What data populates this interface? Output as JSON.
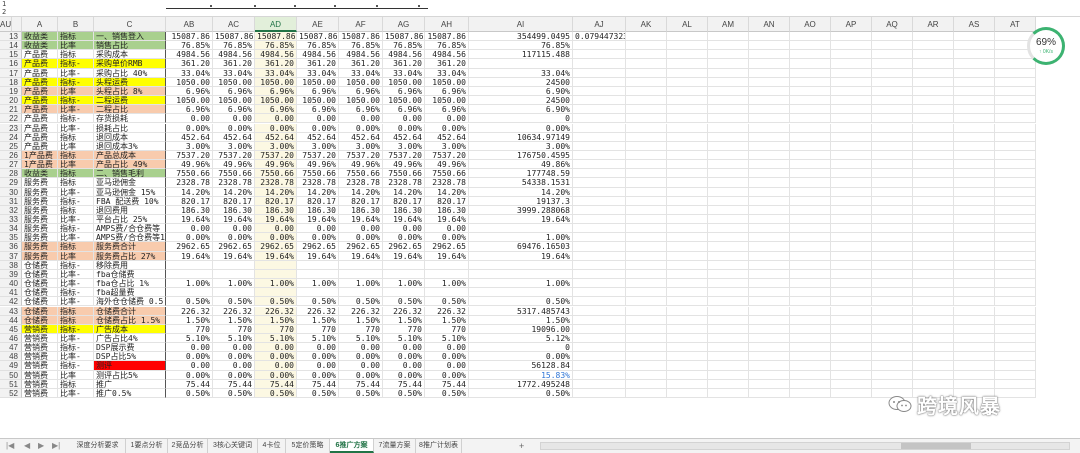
{
  "colors": {
    "green": "#a9d08e",
    "yellow": "#ffff00",
    "orange": "#f8cbad",
    "red": "#ff0000",
    "selected_col_fill": "#fcf8e3",
    "accent": "#217346"
  },
  "columns": [
    "A",
    "B",
    "C",
    "AB",
    "AC",
    "AD",
    "AE",
    "AF",
    "AG",
    "AH",
    "AI",
    "AJ",
    "AK",
    "AL",
    "AM",
    "AN",
    "AO",
    "AP",
    "AQ",
    "AR",
    "AS",
    "AT",
    "AU"
  ],
  "selected_column": "AD",
  "top_rows": [
    "1",
    "2"
  ],
  "rows": [
    {
      "n": "13",
      "a": "收益类",
      "b": "指标",
      "c": "一、销售登入",
      "v": [
        "15087.86",
        "15087.86",
        "15087.86",
        "15087.86",
        "15087.86",
        "15087.86",
        "15087.86"
      ],
      "ai": "354499.0495",
      "aj": "0.079447323",
      "fill": "green"
    },
    {
      "n": "14",
      "a": "收益类",
      "b": "比率",
      "c": "销售占比",
      "v": [
        "76.85%",
        "76.85%",
        "76.85%",
        "76.85%",
        "76.85%",
        "76.85%",
        "76.85%"
      ],
      "ai": "76.85%",
      "fill": "green"
    },
    {
      "n": "15",
      "a": "产品费",
      "b": "指标",
      "c": "采购成本",
      "v": [
        "4984.56",
        "4984.56",
        "4984.56",
        "4984.56",
        "4984.56",
        "4984.56",
        "4984.56"
      ],
      "ai": "117115.488"
    },
    {
      "n": "16",
      "a": "产品费",
      "b": "指标-",
      "c": "采购单价RMB",
      "v": [
        "361.20",
        "361.20",
        "361.20",
        "361.20",
        "361.20",
        "361.20",
        "361.20"
      ],
      "ai": "",
      "fill": "yellow"
    },
    {
      "n": "17",
      "a": "产品费",
      "b": "比率-",
      "c": "采购占比 40%",
      "v": [
        "33.04%",
        "33.04%",
        "33.04%",
        "33.04%",
        "33.04%",
        "33.04%",
        "33.04%"
      ],
      "ai": "33.04%"
    },
    {
      "n": "18",
      "a": "产品费",
      "b": "指标-",
      "c": "头程运费",
      "v": [
        "1050.00",
        "1050.00",
        "1050.00",
        "1050.00",
        "1050.00",
        "1050.00",
        "1050.00"
      ],
      "ai": "24500",
      "fill": "yellow"
    },
    {
      "n": "19",
      "a": "产品费",
      "b": "比率",
      "c": "头程占比 8%",
      "v": [
        "6.96%",
        "6.96%",
        "6.96%",
        "6.96%",
        "6.96%",
        "6.96%",
        "6.96%"
      ],
      "ai": "6.90%",
      "fill": "orange"
    },
    {
      "n": "20",
      "a": "产品费",
      "b": "指标-",
      "c": "二程运费",
      "v": [
        "1050.00",
        "1050.00",
        "1050.00",
        "1050.00",
        "1050.00",
        "1050.00",
        "1050.00"
      ],
      "ai": "24500",
      "fill": "yellow"
    },
    {
      "n": "21",
      "a": "产品费",
      "b": "比率-",
      "c": "二程占比",
      "v": [
        "6.96%",
        "6.96%",
        "6.96%",
        "6.96%",
        "6.96%",
        "6.96%",
        "6.96%"
      ],
      "ai": "6.90%",
      "fill": "orange"
    },
    {
      "n": "22",
      "a": "产品费",
      "b": "指标-",
      "c": "存货损耗",
      "v": [
        "0.00",
        "0.00",
        "0.00",
        "0.00",
        "0.00",
        "0.00",
        "0.00"
      ],
      "ai": "0"
    },
    {
      "n": "23",
      "a": "产品费",
      "b": "比率-",
      "c": "损耗占比",
      "v": [
        "0.00%",
        "0.00%",
        "0.00%",
        "0.00%",
        "0.00%",
        "0.00%",
        "0.00%"
      ],
      "ai": "0.00%"
    },
    {
      "n": "24",
      "a": "产品费",
      "b": "指标",
      "c": "退回成本",
      "v": [
        "452.64",
        "452.64",
        "452.64",
        "452.64",
        "452.64",
        "452.64",
        "452.64"
      ],
      "ai": "10634.97149"
    },
    {
      "n": "25",
      "a": "产品费",
      "b": "比率",
      "c": "退回成本3%",
      "v": [
        "3.00%",
        "3.00%",
        "3.00%",
        "3.00%",
        "3.00%",
        "3.00%",
        "3.00%"
      ],
      "ai": "3.00%"
    },
    {
      "n": "26",
      "a": "1产品费",
      "b": "指标",
      "c": "产品总成本",
      "v": [
        "7537.20",
        "7537.20",
        "7537.20",
        "7537.20",
        "7537.20",
        "7537.20",
        "7537.20"
      ],
      "ai": "176750.4595",
      "fill": "orange"
    },
    {
      "n": "27",
      "a": "1产品费",
      "b": "比率",
      "c": "产品占比 49%",
      "v": [
        "49.96%",
        "49.96%",
        "49.96%",
        "49.96%",
        "49.96%",
        "49.96%",
        "49.96%"
      ],
      "ai": "49.86%",
      "fill": "orange"
    },
    {
      "n": "28",
      "a": "收益类",
      "b": "指标",
      "c": "二、销售毛利",
      "v": [
        "7550.66",
        "7550.66",
        "7550.66",
        "7550.66",
        "7550.66",
        "7550.66",
        "7550.66"
      ],
      "ai": "177748.59",
      "fill": "green"
    },
    {
      "n": "29",
      "a": "服务费",
      "b": "指标",
      "c": "亚马逊佣金",
      "v": [
        "2328.78",
        "2328.78",
        "2328.78",
        "2328.78",
        "2328.78",
        "2328.78",
        "2328.78"
      ],
      "ai": "54338.1531"
    },
    {
      "n": "30",
      "a": "服务费",
      "b": "比率-",
      "c": "亚马逊佣金 15%",
      "v": [
        "14.20%",
        "14.20%",
        "14.20%",
        "14.20%",
        "14.20%",
        "14.20%",
        "14.20%"
      ],
      "ai": "14.20%"
    },
    {
      "n": "31",
      "a": "服务费",
      "b": "指标-",
      "c": "FBA 配送费 10%",
      "v": [
        "820.17",
        "820.17",
        "820.17",
        "820.17",
        "820.17",
        "820.17",
        "820.17"
      ],
      "ai": "19137.3"
    },
    {
      "n": "32",
      "a": "服务费",
      "b": "指标",
      "c": "退回费用",
      "v": [
        "186.30",
        "186.30",
        "186.30",
        "186.30",
        "186.30",
        "186.30",
        "186.30"
      ],
      "ai": "3999.288068"
    },
    {
      "n": "33",
      "a": "服务费",
      "b": "比率-",
      "c": "平台占比 25%",
      "v": [
        "19.64%",
        "19.64%",
        "19.64%",
        "19.64%",
        "19.64%",
        "19.64%",
        "19.64%"
      ],
      "ai": "19.64%"
    },
    {
      "n": "34",
      "a": "服务费",
      "b": "指标-",
      "c": "AMPS费/合仓费等",
      "v": [
        "0.00",
        "0.00",
        "0.00",
        "0.00",
        "0.00",
        "0.00",
        "0.00"
      ],
      "ai": ""
    },
    {
      "n": "35",
      "a": "服务费",
      "b": "比率-",
      "c": "AMPS费/合仓费等1",
      "v": [
        "0.00%",
        "0.00%",
        "0.00%",
        "0.00%",
        "0.00%",
        "0.00%",
        "0.00%"
      ],
      "ai": "1.00%"
    },
    {
      "n": "36",
      "a": "服务费",
      "b": "指标",
      "c": "服务费合计",
      "v": [
        "2962.65",
        "2962.65",
        "2962.65",
        "2962.65",
        "2962.65",
        "2962.65",
        "2962.65"
      ],
      "ai": "69476.16503",
      "fill": "orange"
    },
    {
      "n": "37",
      "a": "服务费",
      "b": "比率",
      "c": "服务费占比 27%",
      "v": [
        "19.64%",
        "19.64%",
        "19.64%",
        "19.64%",
        "19.64%",
        "19.64%",
        "19.64%"
      ],
      "ai": "19.64%",
      "fill": "orange"
    },
    {
      "n": "38",
      "a": "仓储费",
      "b": "指标-",
      "c": "移除费用",
      "v": [
        "",
        "",
        "",
        "",
        "",
        "",
        ""
      ],
      "ai": ""
    },
    {
      "n": "39",
      "a": "仓储费",
      "b": "比率-",
      "c": "fba仓储费",
      "v": [
        "",
        "",
        "",
        "",
        "",
        "",
        ""
      ],
      "ai": ""
    },
    {
      "n": "40",
      "a": "仓储费",
      "b": "比率-",
      "c": "fba仓占比 1%",
      "v": [
        "1.00%",
        "1.00%",
        "1.00%",
        "1.00%",
        "1.00%",
        "1.00%",
        "1.00%"
      ],
      "ai": "1.00%"
    },
    {
      "n": "41",
      "a": "仓储费",
      "b": "指标-",
      "c": "fba超量费",
      "v": [
        "",
        "",
        "",
        "",
        "",
        "",
        ""
      ],
      "ai": ""
    },
    {
      "n": "42",
      "a": "仓储费",
      "b": "比率-",
      "c": "海外仓仓储费 0.5",
      "v": [
        "0.50%",
        "0.50%",
        "0.50%",
        "0.50%",
        "0.50%",
        "0.50%",
        "0.50%"
      ],
      "ai": "0.50%"
    },
    {
      "n": "43",
      "a": "仓储费",
      "b": "指标",
      "c": "仓储费合计",
      "v": [
        "226.32",
        "226.32",
        "226.32",
        "226.32",
        "226.32",
        "226.32",
        "226.32"
      ],
      "ai": "5317.485743",
      "fill": "orange"
    },
    {
      "n": "44",
      "a": "仓储费",
      "b": "指标",
      "c": "仓储费占比 1.5%",
      "v": [
        "1.50%",
        "1.50%",
        "1.50%",
        "1.50%",
        "1.50%",
        "1.50%",
        "1.50%"
      ],
      "ai": "1.50%",
      "fill": "orange"
    },
    {
      "n": "45",
      "a": "营销费",
      "b": "指标-",
      "c": "广告成本",
      "v": [
        "770",
        "770",
        "770",
        "770",
        "770",
        "770",
        "770"
      ],
      "ai": "19096.00",
      "fill": "yellow"
    },
    {
      "n": "46",
      "a": "营销费",
      "b": "比率-",
      "c": "广告占比4%",
      "v": [
        "5.10%",
        "5.10%",
        "5.10%",
        "5.10%",
        "5.10%",
        "5.10%",
        "5.10%"
      ],
      "ai": "5.12%"
    },
    {
      "n": "47",
      "a": "营销费",
      "b": "指标-",
      "c": "DSP展示费",
      "v": [
        "0.00",
        "0.00",
        "0.00",
        "0.00",
        "0.00",
        "0.00",
        "0.00"
      ],
      "ai": "0"
    },
    {
      "n": "48",
      "a": "营销费",
      "b": "比率-",
      "c": "DSP占比5%",
      "v": [
        "0.00%",
        "0.00%",
        "0.00%",
        "0.00%",
        "0.00%",
        "0.00%",
        "0.00%"
      ],
      "ai": "0.00%"
    },
    {
      "n": "49",
      "a": "营销费",
      "b": "指标-",
      "c": "测评",
      "v": [
        "0.00",
        "0.00",
        "0.00",
        "0.00",
        "0.00",
        "0.00",
        "0.00"
      ],
      "ai": "56128.84",
      "fill": "red"
    },
    {
      "n": "50",
      "a": "营销费",
      "b": "比率",
      "c": "测评占比5%",
      "v": [
        "0.00%",
        "0.00%",
        "0.00%",
        "0.00%",
        "0.00%",
        "0.00%",
        "0.00%"
      ],
      "ai": "15.83%",
      "ai_blue": true
    },
    {
      "n": "51",
      "a": "营销费",
      "b": "指标",
      "c": "推广",
      "v": [
        "75.44",
        "75.44",
        "75.44",
        "75.44",
        "75.44",
        "75.44",
        "75.44"
      ],
      "ai": "1772.495248"
    },
    {
      "n": "52",
      "a": "营销费",
      "b": "比率-",
      "c": "推广0.5%",
      "v": [
        "0.50%",
        "0.50%",
        "0.50%",
        "0.50%",
        "0.50%",
        "0.50%",
        "0.50%"
      ],
      "ai": "0.50%"
    }
  ],
  "tabs": [
    "深度分析要求",
    "1要点分析",
    "2竞品分析",
    "3核心关键词",
    "4卡位",
    "5定价策略",
    "6推广方案",
    "7流量方案",
    "8推广计划表"
  ],
  "active_tab": 6,
  "add_tab_label": "+",
  "tab_nav": [
    "|◀",
    "◀",
    "▶",
    "▶|"
  ],
  "gauge": {
    "value": "69%",
    "sub": "↑ 0K/s",
    "percent": 69
  },
  "watermark_text": "跨境风暴"
}
